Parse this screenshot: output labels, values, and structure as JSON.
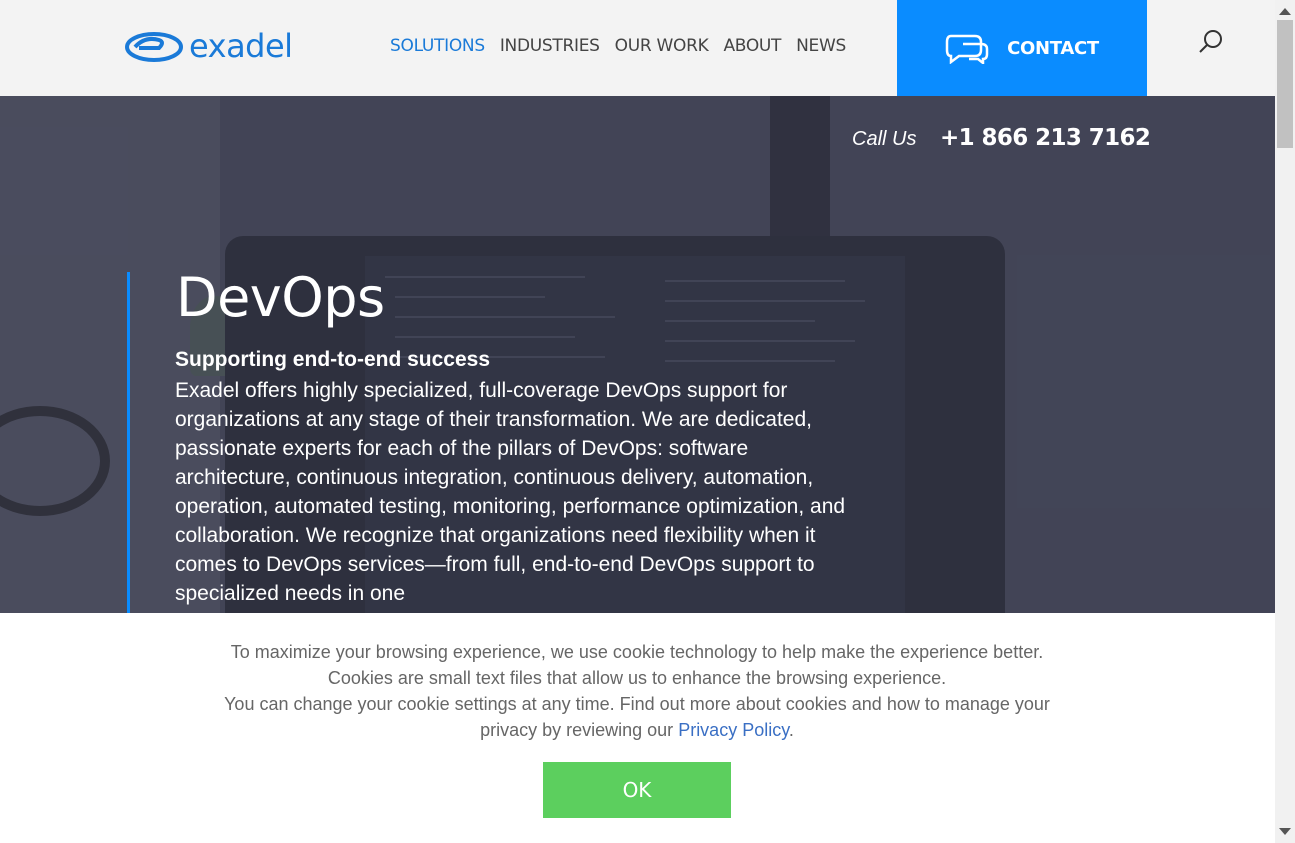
{
  "brand": {
    "name": "exadel",
    "color": "#1a7ad8"
  },
  "nav": {
    "items": [
      {
        "label": "SOLUTIONS",
        "active": true
      },
      {
        "label": "INDUSTRIES",
        "active": false
      },
      {
        "label": "OUR WORK",
        "active": false
      },
      {
        "label": "ABOUT",
        "active": false
      },
      {
        "label": "NEWS",
        "active": false
      }
    ]
  },
  "header": {
    "contact_label": "CONTACT",
    "contact_icon": "chat-bubbles-icon",
    "search_icon": "search-icon",
    "accent": "#0a8cff"
  },
  "hero": {
    "call_label": "Call Us",
    "call_number": "+1 866 213 7162",
    "title": "DevOps",
    "subtitle": "Supporting end-to-end success",
    "description": "Exadel offers highly specialized, full-coverage DevOps support for organizations at any stage of their transformation. We are dedicated, passionate experts for each of the pillars of DevOps: software architecture, continuous integration, continuous delivery, automation, operation, automated testing, monitoring, performance optimization, and collaboration. We recognize that organizations need flexibility when it comes to DevOps services—from full, end-to-end DevOps support to specialized needs in one"
  },
  "cookie": {
    "text_1": "To maximize your browsing experience, we use cookie technology to help make the experience better. Cookies are small text files that allow us to enhance the browsing experience.",
    "text_2": "You can change your cookie settings at any time. Find out more about cookies and how to manage your privacy by reviewing our",
    "link_label": "Privacy Policy",
    "text_end": ".",
    "ok_label": "OK",
    "ok_color": "#5ccf5e"
  }
}
